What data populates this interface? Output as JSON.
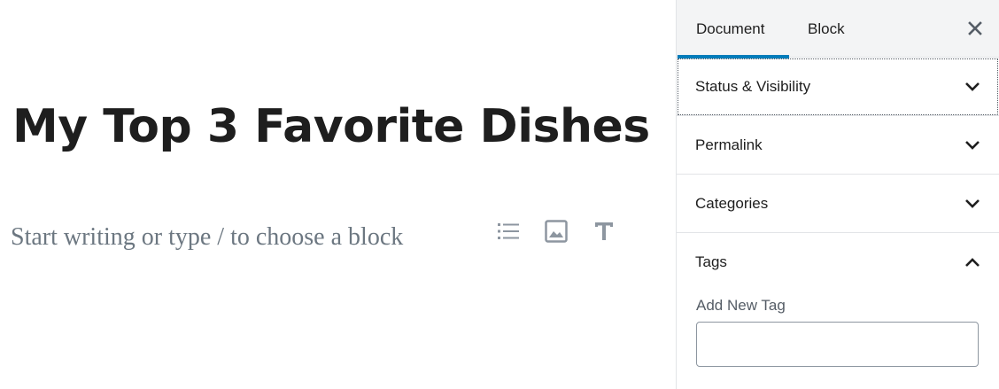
{
  "editor": {
    "title": "My Top 3 Favorite Dishes",
    "placeholder": "Start writing or type / to choose a block",
    "shortcuts": [
      {
        "icon": "list-icon"
      },
      {
        "icon": "image-icon"
      },
      {
        "icon": "heading-icon"
      }
    ]
  },
  "sidebar": {
    "tabs": [
      {
        "label": "Document",
        "active": true
      },
      {
        "label": "Block",
        "active": false
      }
    ],
    "close_icon": "close-icon",
    "panels": [
      {
        "title": "Status & Visibility",
        "expanded": false
      },
      {
        "title": "Permalink",
        "expanded": false
      },
      {
        "title": "Categories",
        "expanded": false
      },
      {
        "title": "Tags",
        "expanded": true
      }
    ],
    "tags": {
      "add_label": "Add New Tag",
      "input_value": ""
    }
  },
  "colors": {
    "accent": "#007cba",
    "text": "#1e1e1e",
    "placeholder": "#6c7781",
    "header_bg": "#f3f4f5",
    "border": "#e2e4e7"
  }
}
